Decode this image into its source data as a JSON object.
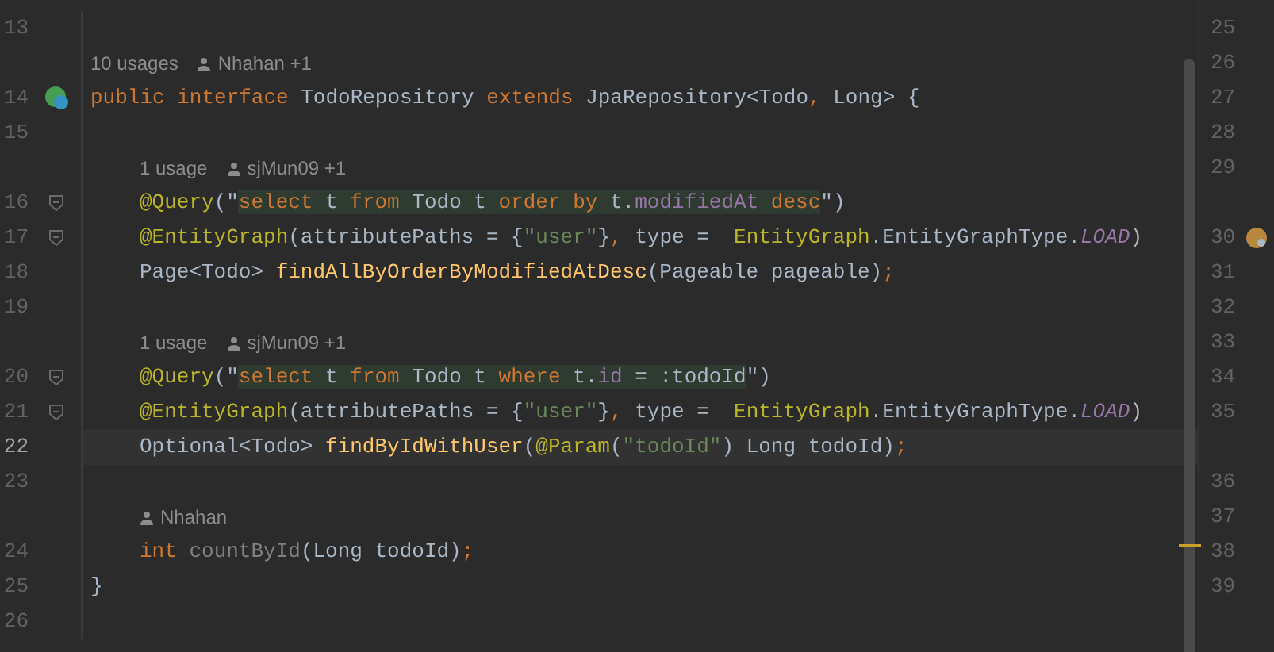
{
  "editor": {
    "lines": [
      {
        "kind": "code",
        "number": "13",
        "current": false
      },
      {
        "kind": "hint",
        "usages": "10 usages",
        "author": "Nhahan +1"
      },
      {
        "kind": "code",
        "number": "14",
        "current": false,
        "implemented": true,
        "tokens": [
          {
            "text": "public interface ",
            "kind": "keyword"
          },
          {
            "text": "TodoRepository ",
            "kind": "plain"
          },
          {
            "text": "extends ",
            "kind": "keyword"
          },
          {
            "text": "JpaRepository<Todo",
            "kind": "plain"
          },
          {
            "text": ",",
            "kind": "keyword"
          },
          {
            "text": " Long> {",
            "kind": "plain"
          }
        ],
        "children": [
          {
            "kind": "code",
            "number": "15",
            "current": false
          },
          {
            "kind": "hint",
            "usages": "1 usage",
            "author": "sjMun09 +1"
          },
          {
            "kind": "code",
            "number": "16",
            "current": false,
            "foldable": true,
            "tokens": [
              {
                "text": "@Query",
                "kind": "annotation"
              },
              {
                "text": "(\"",
                "kind": "plain"
              },
              {
                "text": "select",
                "kind": "sql-keyword"
              },
              {
                "text": " t ",
                "kind": "sql"
              },
              {
                "text": "from",
                "kind": "sql-keyword"
              },
              {
                "text": " Todo t ",
                "kind": "sql"
              },
              {
                "text": "order by",
                "kind": "sql-keyword"
              },
              {
                "text": " t.",
                "kind": "sql"
              },
              {
                "text": "modifiedAt",
                "kind": "sql-field"
              },
              {
                "text": " desc",
                "kind": "sql-keyword"
              },
              {
                "text": "\")",
                "kind": "plain"
              }
            ]
          },
          {
            "kind": "code",
            "number": "17",
            "current": false,
            "foldable": true,
            "tokens": [
              {
                "text": "@EntityGraph",
                "kind": "annotation"
              },
              {
                "text": "(attributePaths = {",
                "kind": "plain"
              },
              {
                "text": "\"user\"",
                "kind": "string"
              },
              {
                "text": "}",
                "kind": "plain"
              },
              {
                "text": ",",
                "kind": "keyword"
              },
              {
                "text": " type =  ",
                "kind": "plain"
              },
              {
                "text": "EntityGraph",
                "kind": "annotation"
              },
              {
                "text": ".EntityGraphType.",
                "kind": "plain"
              },
              {
                "text": "LOAD",
                "kind": "constant"
              },
              {
                "text": ")",
                "kind": "plain"
              }
            ]
          },
          {
            "kind": "code",
            "number": "18",
            "current": false,
            "tokens": [
              {
                "text": "Page<Todo> ",
                "kind": "plain"
              },
              {
                "text": "findAllByOrderByModifiedAtDesc",
                "kind": "method"
              },
              {
                "text": "(Pageable pageable)",
                "kind": "plain"
              },
              {
                "text": ";",
                "kind": "keyword"
              }
            ]
          },
          {
            "kind": "code",
            "number": "19",
            "current": false
          },
          {
            "kind": "hint",
            "usages": "1 usage",
            "author": "sjMun09 +1"
          },
          {
            "kind": "code",
            "number": "20",
            "current": false,
            "foldable": true,
            "tokens": [
              {
                "text": "@Query",
                "kind": "annotation"
              },
              {
                "text": "(\"",
                "kind": "plain"
              },
              {
                "text": "select",
                "kind": "sql-keyword"
              },
              {
                "text": " t ",
                "kind": "sql"
              },
              {
                "text": "from",
                "kind": "sql-keyword"
              },
              {
                "text": " Todo t ",
                "kind": "sql"
              },
              {
                "text": "where",
                "kind": "sql-keyword"
              },
              {
                "text": " t.",
                "kind": "sql"
              },
              {
                "text": "id",
                "kind": "sql-field"
              },
              {
                "text": " = :todoId",
                "kind": "sql"
              },
              {
                "text": "\")",
                "kind": "plain"
              }
            ]
          },
          {
            "kind": "code",
            "number": "21",
            "current": false,
            "foldable": true,
            "tokens": [
              {
                "text": "@EntityGraph",
                "kind": "annotation"
              },
              {
                "text": "(attributePaths = {",
                "kind": "plain"
              },
              {
                "text": "\"user\"",
                "kind": "string"
              },
              {
                "text": "}",
                "kind": "plain"
              },
              {
                "text": ",",
                "kind": "keyword"
              },
              {
                "text": " type =  ",
                "kind": "plain"
              },
              {
                "text": "EntityGraph",
                "kind": "annotation"
              },
              {
                "text": ".EntityGraphType.",
                "kind": "plain"
              },
              {
                "text": "LOAD",
                "kind": "constant"
              },
              {
                "text": ")",
                "kind": "plain"
              }
            ]
          },
          {
            "kind": "code",
            "number": "22",
            "current": true,
            "tokens": [
              {
                "text": "Optional<Todo> ",
                "kind": "plain"
              },
              {
                "text": "findByIdWithUser",
                "kind": "method"
              },
              {
                "text": "(",
                "kind": "plain"
              },
              {
                "text": "@Param",
                "kind": "annotation"
              },
              {
                "text": "(",
                "kind": "plain"
              },
              {
                "text": "\"todoId\"",
                "kind": "string"
              },
              {
                "text": ") Long todoId)",
                "kind": "plain"
              },
              {
                "text": ";",
                "kind": "keyword"
              }
            ]
          },
          {
            "kind": "code",
            "number": "23",
            "current": false
          },
          {
            "kind": "hint",
            "author": "Nhahan"
          },
          {
            "kind": "code",
            "number": "24",
            "current": false,
            "tokens": [
              {
                "text": "int ",
                "kind": "keyword"
              },
              {
                "text": "countById",
                "kind": "unused"
              },
              {
                "text": "(Long todoId)",
                "kind": "plain"
              },
              {
                "text": ";",
                "kind": "keyword"
              }
            ]
          }
        ]
      },
      {
        "kind": "code",
        "number": "25",
        "current": false,
        "tokens": [
          {
            "text": "}",
            "kind": "plain"
          }
        ]
      },
      {
        "kind": "code",
        "number": "26",
        "current": false
      }
    ]
  },
  "right_gutter": {
    "lines": [
      {
        "kind": "number",
        "number": "25"
      },
      {
        "kind": "number",
        "number": "26"
      },
      {
        "kind": "number",
        "number": "27"
      },
      {
        "kind": "number",
        "number": "28"
      },
      {
        "kind": "number",
        "number": "29"
      },
      {
        "kind": "gap"
      },
      {
        "kind": "number",
        "number": "30",
        "overridden": true
      },
      {
        "kind": "number",
        "number": "31"
      },
      {
        "kind": "number",
        "number": "32"
      },
      {
        "kind": "number",
        "number": "33"
      },
      {
        "kind": "number",
        "number": "34"
      },
      {
        "kind": "number",
        "number": "35"
      },
      {
        "kind": "gap"
      },
      {
        "kind": "number",
        "number": "36"
      },
      {
        "kind": "number",
        "number": "37"
      },
      {
        "kind": "number",
        "number": "38"
      },
      {
        "kind": "number",
        "number": "39"
      }
    ]
  }
}
